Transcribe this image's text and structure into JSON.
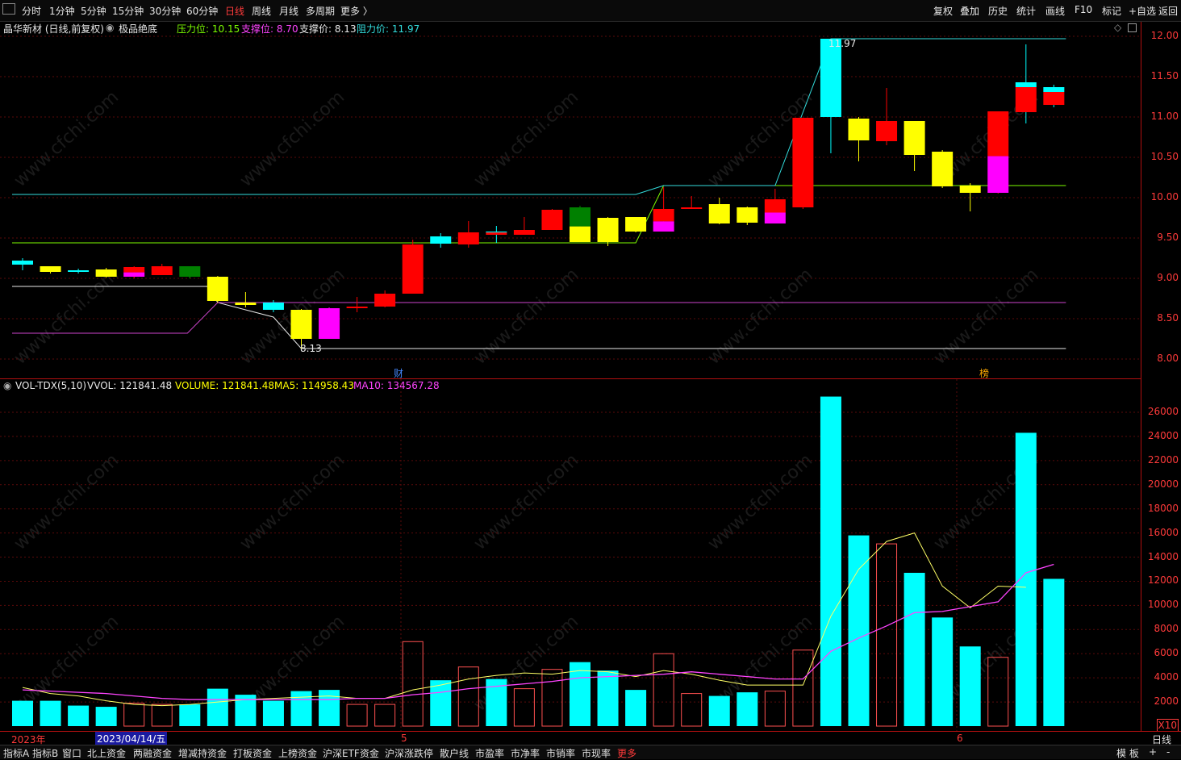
{
  "toolbar": {
    "left_icon": "panel-toggle-icon",
    "periods": [
      "分时",
      "1分钟",
      "5分钟",
      "15分钟",
      "30分钟",
      "60分钟",
      "日线",
      "周线",
      "月线",
      "多周期",
      "更多 〉"
    ],
    "active_period": "日线",
    "right_buttons": [
      "复权",
      "叠加",
      "历史",
      "统计",
      "画线",
      "F10",
      "标记",
      "+自选",
      "返回"
    ]
  },
  "info": {
    "stock_title": "晶华新材 (日线,前复权)",
    "indicator_name": "极品绝底",
    "pressure_label": "压力位: 10.15",
    "support1_label": "支撑位: 8.70",
    "support2_label": "支撑价: 8.13",
    "resistance_label": "阻力价: 11.97"
  },
  "colors": {
    "up": "#ff0000",
    "down": "#00ffff",
    "yellow": "#ffff00",
    "magenta": "#ff00ff",
    "green": "#008000",
    "pressure_line": "#7cfc00",
    "support_line": "#cc44cc",
    "axis_red": "#ff3a3a"
  },
  "price_axis": {
    "ticks": [
      "12.00",
      "11.50",
      "11.00",
      "10.50",
      "10.00",
      "9.50",
      "9.00",
      "8.50",
      "8.00"
    ],
    "min": 7.8,
    "max": 12.15
  },
  "price_annotations": {
    "high_label": "11.97",
    "low_label": "8.13",
    "marker_cai": "财",
    "marker_bang": "榜"
  },
  "volume_info": {
    "name": "VOL-TDX(5,10)",
    "vvol": "VVOL: 121841.48",
    "volume": "VOLUME: 121841.48",
    "ma5": "MA5: 114958.43",
    "ma10": "MA10: 134567.28"
  },
  "volume_axis": {
    "ticks": [
      "26000",
      "24000",
      "22000",
      "20000",
      "18000",
      "16000",
      "14000",
      "12000",
      "10000",
      "8000",
      "6000",
      "4000",
      "2000"
    ],
    "unit": "X10",
    "max": 28000
  },
  "date_axis": {
    "labels": [
      "2023年",
      "2023/04/14/五",
      "5",
      "6"
    ],
    "right_label": "日线"
  },
  "bottom_tabs": [
    "指标A",
    "指标B",
    "窗口",
    "北上资金",
    "两融资金",
    "增减持资金",
    "打板资金",
    "上榜资金",
    "沪深ETF资金",
    "沪深涨跌停",
    "散户线",
    "市盈率",
    "市净率",
    "市销率",
    "市现率",
    "更多"
  ],
  "bottom_right": [
    "模 板",
    "+",
    "-"
  ],
  "watermark": "www.cfchi.com",
  "chart_data": {
    "type": "candlestick",
    "candles": [
      {
        "o": 9.17,
        "h": 9.25,
        "l": 9.1,
        "c": 9.22,
        "v": 2100,
        "col": "cyan"
      },
      {
        "o": 9.15,
        "h": 9.15,
        "l": 9.06,
        "c": 9.08,
        "v": 2100,
        "col": "yellow"
      },
      {
        "o": 9.1,
        "h": 9.12,
        "l": 9.06,
        "c": 9.08,
        "v": 1700,
        "col": "cyan"
      },
      {
        "o": 9.11,
        "h": 9.13,
        "l": 9.01,
        "c": 9.02,
        "v": 1600,
        "col": "yellow"
      },
      {
        "o": 9.02,
        "h": 9.15,
        "l": 9.0,
        "c": 9.14,
        "v": 1900,
        "col": "redmag"
      },
      {
        "o": 9.04,
        "h": 9.18,
        "l": 9.04,
        "c": 9.15,
        "v": 1800,
        "col": "red"
      },
      {
        "o": 9.15,
        "h": 9.15,
        "l": 9.0,
        "c": 9.02,
        "v": 1800,
        "col": "green"
      },
      {
        "o": 9.02,
        "h": 9.03,
        "l": 8.7,
        "c": 8.72,
        "v": 3100,
        "col": "yellow"
      },
      {
        "o": 8.7,
        "h": 8.83,
        "l": 8.64,
        "c": 8.67,
        "v": 2600,
        "col": "yellow"
      },
      {
        "o": 8.7,
        "h": 8.73,
        "l": 8.58,
        "c": 8.61,
        "v": 2100,
        "col": "cyan"
      },
      {
        "o": 8.61,
        "h": 8.62,
        "l": 8.13,
        "c": 8.25,
        "v": 2900,
        "col": "yellow"
      },
      {
        "o": 8.25,
        "h": 8.64,
        "l": 8.25,
        "c": 8.63,
        "v": 3000,
        "col": "magenta"
      },
      {
        "o": 8.63,
        "h": 8.77,
        "l": 8.58,
        "c": 8.65,
        "v": 1800,
        "col": "red"
      },
      {
        "o": 8.65,
        "h": 8.85,
        "l": 8.64,
        "c": 8.81,
        "v": 1800,
        "col": "red"
      },
      {
        "o": 8.81,
        "h": 9.48,
        "l": 8.81,
        "c": 9.42,
        "v": 7000,
        "col": "red"
      },
      {
        "o": 9.43,
        "h": 9.56,
        "l": 9.38,
        "c": 9.52,
        "v": 3800,
        "col": "cyan"
      },
      {
        "o": 9.42,
        "h": 9.71,
        "l": 9.38,
        "c": 9.57,
        "v": 4900,
        "col": "red"
      },
      {
        "o": 9.54,
        "h": 9.65,
        "l": 9.44,
        "c": 9.58,
        "v": 3900,
        "col": "cyanred"
      },
      {
        "o": 9.54,
        "h": 9.76,
        "l": 9.54,
        "c": 9.6,
        "v": 3100,
        "col": "red"
      },
      {
        "o": 9.6,
        "h": 9.86,
        "l": 9.6,
        "c": 9.85,
        "v": 4700,
        "col": "red"
      },
      {
        "o": 9.88,
        "h": 9.9,
        "l": 9.45,
        "c": 9.45,
        "v": 5300,
        "col": "greenyellow"
      },
      {
        "o": 9.75,
        "h": 9.76,
        "l": 9.4,
        "c": 9.45,
        "v": 4600,
        "col": "yellow"
      },
      {
        "o": 9.76,
        "h": 9.76,
        "l": 9.57,
        "c": 9.58,
        "v": 3000,
        "col": "yellow"
      },
      {
        "o": 9.58,
        "h": 10.13,
        "l": 9.58,
        "c": 9.86,
        "v": 6000,
        "col": "redmag"
      },
      {
        "o": 9.88,
        "h": 10.02,
        "l": 9.86,
        "c": 9.88,
        "v": 2700,
        "col": "red"
      },
      {
        "o": 9.92,
        "h": 10.0,
        "l": 9.67,
        "c": 9.68,
        "v": 2500,
        "col": "yellow"
      },
      {
        "o": 9.88,
        "h": 9.89,
        "l": 9.66,
        "c": 9.69,
        "v": 2800,
        "col": "yellow"
      },
      {
        "o": 9.68,
        "h": 10.11,
        "l": 9.68,
        "c": 9.98,
        "v": 2900,
        "col": "redmag"
      },
      {
        "o": 9.88,
        "h": 10.0,
        "l": 9.86,
        "c": 10.99,
        "v": 6300,
        "col": "red"
      },
      {
        "o": 11.97,
        "h": 11.97,
        "l": 10.55,
        "c": 11.0,
        "v": 27300,
        "col": "cyan"
      },
      {
        "o": 10.98,
        "h": 11.0,
        "l": 10.45,
        "c": 10.71,
        "v": 15800,
        "col": "yellow"
      },
      {
        "o": 10.7,
        "h": 11.36,
        "l": 10.65,
        "c": 10.95,
        "v": 15100,
        "col": "red"
      },
      {
        "o": 10.95,
        "h": 10.95,
        "l": 10.33,
        "c": 10.53,
        "v": 12700,
        "col": "yellow"
      },
      {
        "o": 10.57,
        "h": 10.59,
        "l": 10.12,
        "c": 10.14,
        "v": 9000,
        "col": "yellow"
      },
      {
        "o": 10.15,
        "h": 10.18,
        "l": 9.83,
        "c": 10.06,
        "v": 6600,
        "col": "yellow"
      },
      {
        "o": 10.06,
        "h": 11.07,
        "l": 10.05,
        "c": 11.07,
        "v": 5700,
        "col": "redmag"
      },
      {
        "o": 11.43,
        "h": 11.9,
        "l": 10.92,
        "c": 11.06,
        "v": 24300,
        "col": "cyanred"
      },
      {
        "o": 11.37,
        "h": 11.4,
        "l": 11.12,
        "c": 11.15,
        "v": 12200,
        "col": "cyanred"
      }
    ],
    "series": [
      {
        "name": "MA5",
        "values": [
          3200,
          2700,
          2500,
          2100,
          1800,
          1700,
          1800,
          2000,
          2200,
          2300,
          2400,
          2500,
          2300,
          2300,
          3000,
          3400,
          3900,
          4200,
          4400,
          4300,
          4600,
          4500,
          4100,
          4600,
          4300,
          3800,
          3400,
          3400,
          3400,
          9100,
          13000,
          15300,
          16000,
          11600,
          9800,
          11600,
          11500
        ]
      },
      {
        "name": "MA10",
        "values": [
          3000,
          2900,
          2800,
          2700,
          2500,
          2300,
          2200,
          2200,
          2200,
          2200,
          2200,
          2200,
          2300,
          2300,
          2600,
          2800,
          3100,
          3300,
          3500,
          3700,
          4000,
          4100,
          4200,
          4300,
          4500,
          4300,
          4100,
          3900,
          3900,
          6200,
          7300,
          8300,
          9400,
          9500,
          9900,
          10300,
          12700,
          13400
        ]
      }
    ],
    "pressure_level": 10.15,
    "support_level": 8.7,
    "support_price": 8.13,
    "resistance_price": 11.97,
    "volume_unit": "X10"
  }
}
